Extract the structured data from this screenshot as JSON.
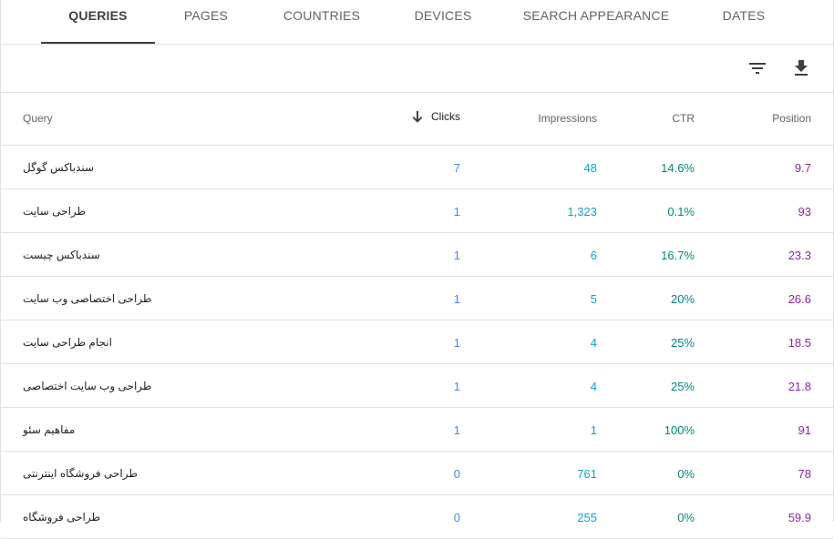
{
  "tabs": [
    {
      "label": "QUERIES",
      "active": true
    },
    {
      "label": "PAGES",
      "active": false
    },
    {
      "label": "COUNTRIES",
      "active": false
    },
    {
      "label": "DEVICES",
      "active": false
    },
    {
      "label": "SEARCH APPEARANCE",
      "active": false
    },
    {
      "label": "DATES",
      "active": false
    }
  ],
  "toolbar": {
    "filter_icon": "filter-icon",
    "download_icon": "download-icon"
  },
  "table": {
    "headers": {
      "query": "Query",
      "clicks": "Clicks",
      "impressions": "Impressions",
      "ctr": "CTR",
      "position": "Position"
    },
    "sort_icon": "arrow-down-icon",
    "rows": [
      {
        "query": "سندباکس گوگل",
        "clicks": "7",
        "impressions": "48",
        "ctr": "14.6%",
        "position": "9.7"
      },
      {
        "query": "طراحی سایت",
        "clicks": "1",
        "impressions": "1,323",
        "ctr": "0.1%",
        "position": "93"
      },
      {
        "query": "سندباکس چیست",
        "clicks": "1",
        "impressions": "6",
        "ctr": "16.7%",
        "position": "23.3"
      },
      {
        "query": "طراحی اختصاصی وب سایت",
        "clicks": "1",
        "impressions": "5",
        "ctr": "20%",
        "position": "26.6"
      },
      {
        "query": "انجام طراحی سایت",
        "clicks": "1",
        "impressions": "4",
        "ctr": "25%",
        "position": "18.5"
      },
      {
        "query": "طراحی وب سایت اختصاصی",
        "clicks": "1",
        "impressions": "4",
        "ctr": "25%",
        "position": "21.8"
      },
      {
        "query": "مفاهیم سئو",
        "clicks": "1",
        "impressions": "1",
        "ctr": "100%",
        "position": "91"
      },
      {
        "query": "طراحی فروشگاه اینترنتی",
        "clicks": "0",
        "impressions": "761",
        "ctr": "0%",
        "position": "78"
      },
      {
        "query": "طراحی فروشگاه",
        "clicks": "0",
        "impressions": "255",
        "ctr": "0%",
        "position": "59.9"
      }
    ]
  },
  "colors": {
    "clicks": "#4285f4",
    "impressions": "#12a4c4",
    "ctr": "#00897b",
    "position": "#8e24aa"
  }
}
